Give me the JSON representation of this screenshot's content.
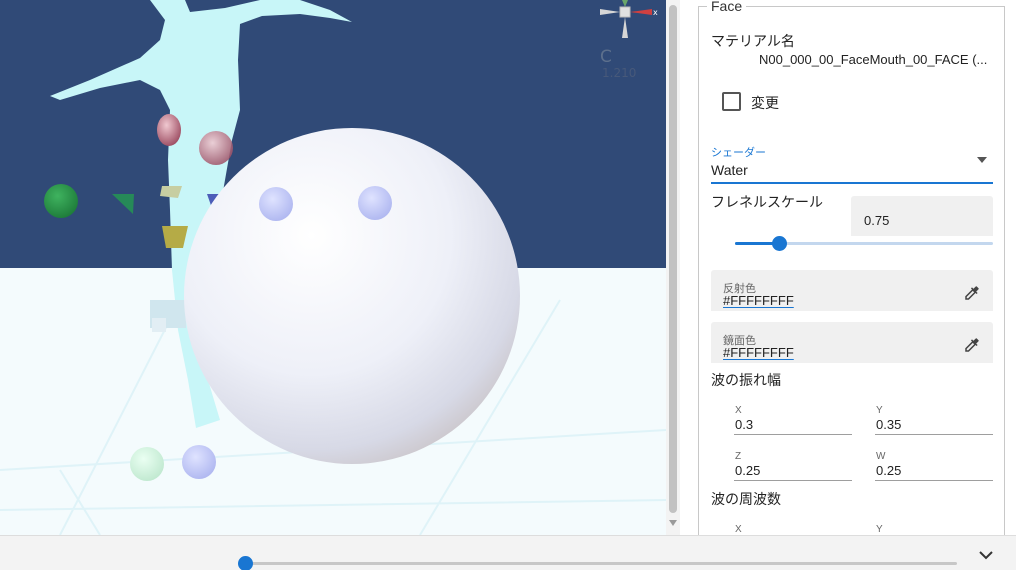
{
  "viewport": {
    "gizmo_axis_label": "x",
    "gizmo_camera_label": "C",
    "gizmo_value": "1.210",
    "colors": {
      "sky": "#304a77",
      "floor": "#f4fbfd",
      "character": "#c8f6f8",
      "sphere": "#eef0f8"
    }
  },
  "panel": {
    "section_title": "Face",
    "material_label": "マテリアル名",
    "material_value": "N00_000_00_FaceMouth_00_FACE (...",
    "change_checkbox_label": "変更",
    "change_checked": false,
    "shader": {
      "label": "シェーダー",
      "value": "Water"
    },
    "fresnel": {
      "label": "フレネルスケール",
      "value": "0.75",
      "slider_fraction": 0.17
    },
    "reflection_color": {
      "label": "反射色",
      "value": "#FFFFFFFF"
    },
    "specular_color": {
      "label": "鏡面色",
      "value": "#FFFFFFFF"
    },
    "wave_amplitude": {
      "label": "波の振れ幅",
      "x": {
        "label": "X",
        "value": "0.3"
      },
      "y": {
        "label": "Y",
        "value": "0.35"
      },
      "z": {
        "label": "Z",
        "value": "0.25"
      },
      "w": {
        "label": "W",
        "value": "0.25"
      }
    },
    "wave_frequency": {
      "label": "波の周波数",
      "x": {
        "label": "X"
      },
      "y": {
        "label": "Y"
      }
    }
  },
  "bottom": {
    "slider_fraction": 0.0
  },
  "accent_color": "#1976d2"
}
